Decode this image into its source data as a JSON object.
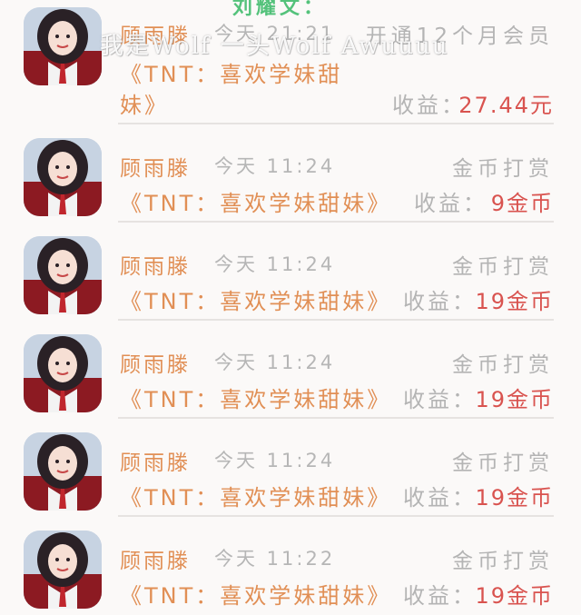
{
  "overlay": {
    "top_text": "刘耀文：",
    "watermark": "我是Wolf 一头Wolf Awuuuu"
  },
  "first_record": {
    "name": "顾雨滕",
    "time": "今天 21:21",
    "type": "开通12个月会员",
    "title_line1": "《TNT：喜欢学妹甜",
    "title_line2": "妹》",
    "income_label": "收益：",
    "income_value": "27.44元"
  },
  "records": [
    {
      "name": "顾雨滕",
      "time": "今天 11:24",
      "type": "金币打赏",
      "title": "《TNT：喜欢学妹甜妹》",
      "income_label": "收益：",
      "income_value": "9金币"
    },
    {
      "name": "顾雨滕",
      "time": "今天 11:24",
      "type": "金币打赏",
      "title": "《TNT：喜欢学妹甜妹》",
      "income_label": "收益：",
      "income_value": "19金币"
    },
    {
      "name": "顾雨滕",
      "time": "今天 11:24",
      "type": "金币打赏",
      "title": "《TNT：喜欢学妹甜妹》",
      "income_label": "收益：",
      "income_value": "19金币"
    },
    {
      "name": "顾雨滕",
      "time": "今天 11:24",
      "type": "金币打赏",
      "title": "《TNT：喜欢学妹甜妹》",
      "income_label": "收益：",
      "income_value": "19金币"
    },
    {
      "name": "顾雨滕",
      "time": "今天 11:22",
      "type": "金币打赏",
      "title": "《TNT：喜欢学妹甜妹》",
      "income_label": "收益：",
      "income_value": "19金币"
    }
  ],
  "colors": {
    "accent_orange": "#e18f55",
    "income_red": "#d9534f",
    "muted_gray": "#b4b4b4",
    "overlay_green": "#54c27b"
  },
  "icons": {
    "avatar": "user-avatar-photo"
  }
}
